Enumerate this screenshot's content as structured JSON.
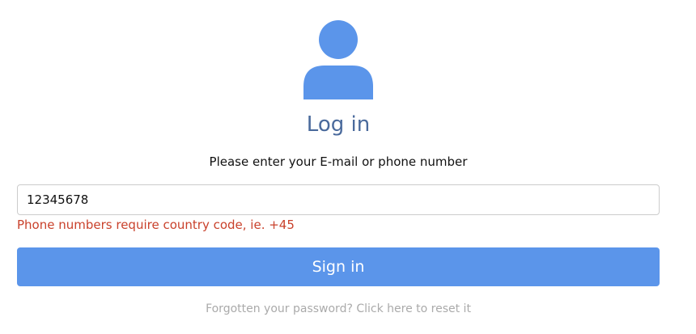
{
  "header": {
    "icon": "user-icon",
    "title": "Log in",
    "prompt": "Please enter your E-mail or phone number"
  },
  "form": {
    "identifier_value": "12345678",
    "error_message": "Phone numbers require country code, ie. +45",
    "submit_label": "Sign in",
    "forgot_link": "Forgotten your password? Click here to reset it"
  },
  "colors": {
    "accent": "#5b95ea",
    "title": "#4a6a9c",
    "error": "#c9412b",
    "muted": "#aaaaaa"
  }
}
